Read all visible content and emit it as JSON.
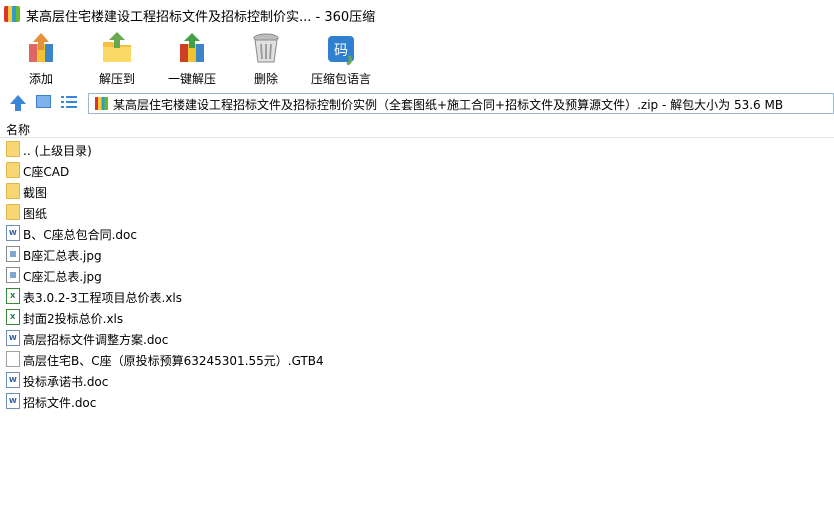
{
  "window": {
    "title": "某高层住宅楼建设工程招标文件及招标控制价实... - 360压缩"
  },
  "toolbar": {
    "items": [
      {
        "label": "添加",
        "icon": "add-archive-icon"
      },
      {
        "label": "解压到",
        "icon": "extract-to-icon"
      },
      {
        "label": "一键解压",
        "icon": "one-click-extract-icon"
      },
      {
        "label": "删除",
        "icon": "delete-trash-icon"
      },
      {
        "label": "压缩包语言",
        "icon": "archive-language-icon"
      }
    ],
    "language_icon_text": "码"
  },
  "address": {
    "path": "某高层住宅楼建设工程招标文件及招标控制价实例（全套图纸+施工合同+招标文件及预算源文件）.zip - 解包大小为 53.6 MB"
  },
  "list": {
    "column_name": "名称",
    "items": [
      {
        "name": ".. (上级目录)",
        "type": "folder"
      },
      {
        "name": "C座CAD",
        "type": "folder"
      },
      {
        "name": "截图",
        "type": "folder"
      },
      {
        "name": "图纸",
        "type": "folder"
      },
      {
        "name": "B、C座总包合同.doc",
        "type": "doc"
      },
      {
        "name": "B座汇总表.jpg",
        "type": "img"
      },
      {
        "name": "C座汇总表.jpg",
        "type": "img"
      },
      {
        "name": "表3.0.2-3工程项目总价表.xls",
        "type": "xls"
      },
      {
        "name": "封面2投标总价.xls",
        "type": "xls"
      },
      {
        "name": "高层招标文件调整方案.doc",
        "type": "doc"
      },
      {
        "name": "高层住宅B、C座（原投标预算63245301.55元）.GTB4",
        "type": "blank"
      },
      {
        "name": "投标承诺书.doc",
        "type": "doc"
      },
      {
        "name": "招标文件.doc",
        "type": "doc"
      }
    ]
  }
}
